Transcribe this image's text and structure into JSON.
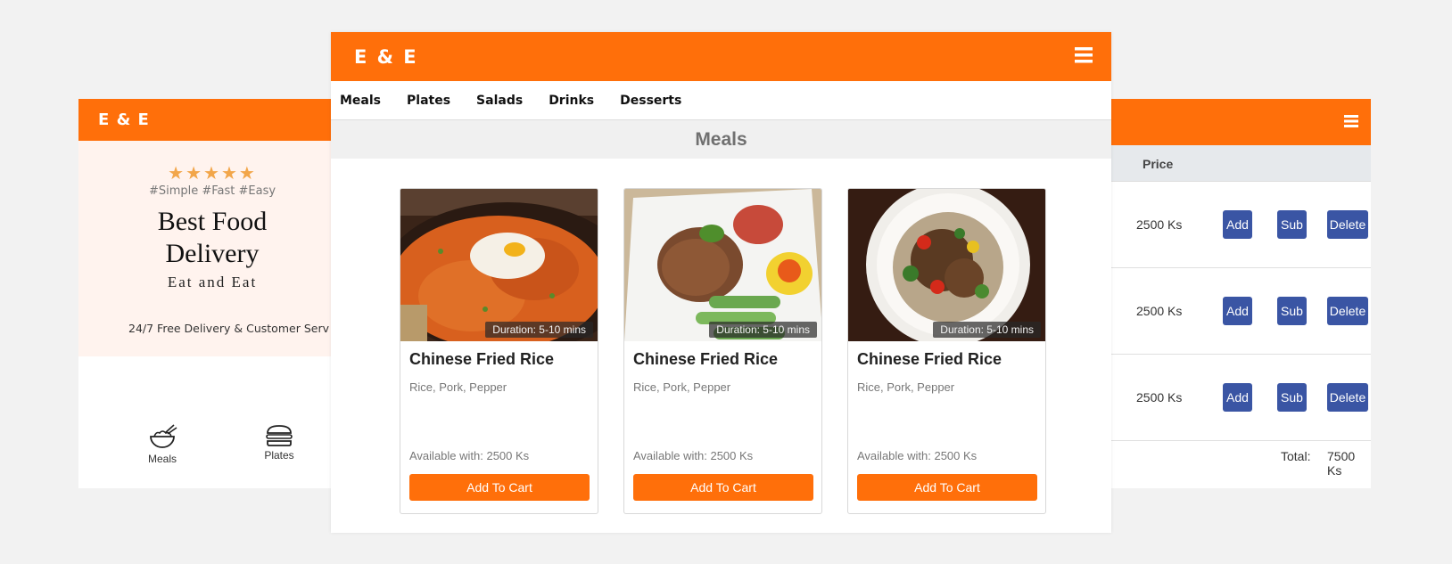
{
  "colors": {
    "accent": "#ff6f0a",
    "button_blue": "#3a55a4",
    "star": "#f2a64a"
  },
  "left": {
    "brand": "E & E",
    "stars": "★★★★★",
    "tags": "#Simple #Fast #Easy",
    "title": "Best Food Delivery",
    "subtitle": "Eat and Eat",
    "note": "24/7 Free Delivery & Customer Serv",
    "categories": [
      {
        "label": "Meals",
        "icon": "rice-bowl-icon"
      },
      {
        "label": "Plates",
        "icon": "burger-icon"
      }
    ]
  },
  "center": {
    "brand": "E & E",
    "nav": [
      "Meals",
      "Plates",
      "Salads",
      "Drinks",
      "Desserts"
    ],
    "section_title": "Meals",
    "cards": [
      {
        "name": "Chinese Fried Rice",
        "ingredients": "Rice, Pork, Pepper",
        "duration": "Duration: 5-10 mins",
        "available": "Available with: 2500 Ks",
        "button": "Add To Cart"
      },
      {
        "name": "Chinese Fried Rice",
        "ingredients": "Rice, Pork, Pepper",
        "duration": "Duration: 5-10 mins",
        "available": "Available with: 2500 Ks",
        "button": "Add To Cart"
      },
      {
        "name": "Chinese Fried Rice",
        "ingredients": "Rice, Pork, Pepper",
        "duration": "Duration: 5-10 mins",
        "available": "Available with: 2500 Ks",
        "button": "Add To Cart"
      }
    ]
  },
  "right": {
    "column_header": "Price",
    "rows": [
      {
        "price": "2500 Ks",
        "add": "Add",
        "sub": "Sub",
        "delete": "Delete"
      },
      {
        "price": "2500 Ks",
        "add": "Add",
        "sub": "Sub",
        "delete": "Delete"
      },
      {
        "price": "2500 Ks",
        "add": "Add",
        "sub": "Sub",
        "delete": "Delete"
      }
    ],
    "total_label": "Total:",
    "total_value": "7500 Ks"
  }
}
